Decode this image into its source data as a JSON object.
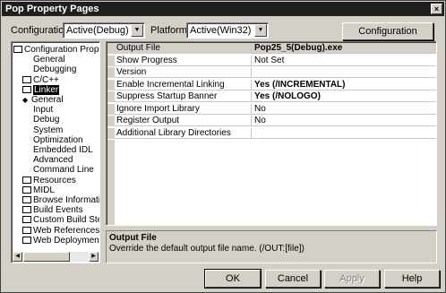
{
  "window": {
    "title": "Pop Property Pages",
    "close_glyph": "×"
  },
  "config_bar": {
    "configuration_label": "Configuration:",
    "configuration_value": "Active(Debug)",
    "platform_label": "Platform:",
    "platform_value": "Active(Win32)",
    "config_manager_label": "Configuration Manager..."
  },
  "tree": {
    "items": [
      {
        "label": "Configuration Properti",
        "kind": "folder-open"
      },
      {
        "label": "General",
        "kind": "leaf"
      },
      {
        "label": "Debugging",
        "kind": "leaf"
      },
      {
        "label": "C/C++",
        "kind": "folder"
      },
      {
        "label": "Linker",
        "kind": "folder-open",
        "selected": true
      },
      {
        "label": "General",
        "kind": "leaf-active"
      },
      {
        "label": "Input",
        "kind": "leaf"
      },
      {
        "label": "Debug",
        "kind": "leaf"
      },
      {
        "label": "System",
        "kind": "leaf"
      },
      {
        "label": "Optimization",
        "kind": "leaf"
      },
      {
        "label": "Embedded IDL",
        "kind": "leaf"
      },
      {
        "label": "Advanced",
        "kind": "leaf"
      },
      {
        "label": "Command Line",
        "kind": "leaf"
      },
      {
        "label": "Resources",
        "kind": "folder"
      },
      {
        "label": "MIDL",
        "kind": "folder"
      },
      {
        "label": "Browse Informatio",
        "kind": "folder"
      },
      {
        "label": "Build Events",
        "kind": "folder"
      },
      {
        "label": "Custom Build Step",
        "kind": "folder"
      },
      {
        "label": "Web References",
        "kind": "folder"
      },
      {
        "label": "Web Deployment",
        "kind": "folder"
      }
    ]
  },
  "properties": {
    "rows": [
      {
        "name": "Output File",
        "value": "Pop25_5(Debug).exe"
      },
      {
        "name": "Show Progress",
        "value": "Not Set"
      },
      {
        "name": "Version",
        "value": ""
      },
      {
        "name": "Enable Incremental Linking",
        "value": "Yes (/INCREMENTAL)"
      },
      {
        "name": "Suppress Startup Banner",
        "value": "Yes (/NOLOGO)"
      },
      {
        "name": "Ignore Import Library",
        "value": "No"
      },
      {
        "name": "Register Output",
        "value": "No"
      },
      {
        "name": "Additional Library Directories",
        "value": ""
      }
    ]
  },
  "description": {
    "title": "Output File",
    "text": "Override the default output file name.      (/OUT:[file])"
  },
  "buttons": {
    "ok": "OK",
    "cancel": "Cancel",
    "apply": "Apply",
    "help": "Help"
  },
  "colors": {
    "titlebar": "#1f1f1f",
    "dialog_face": "#d4d0c8",
    "selection": "#000000"
  }
}
